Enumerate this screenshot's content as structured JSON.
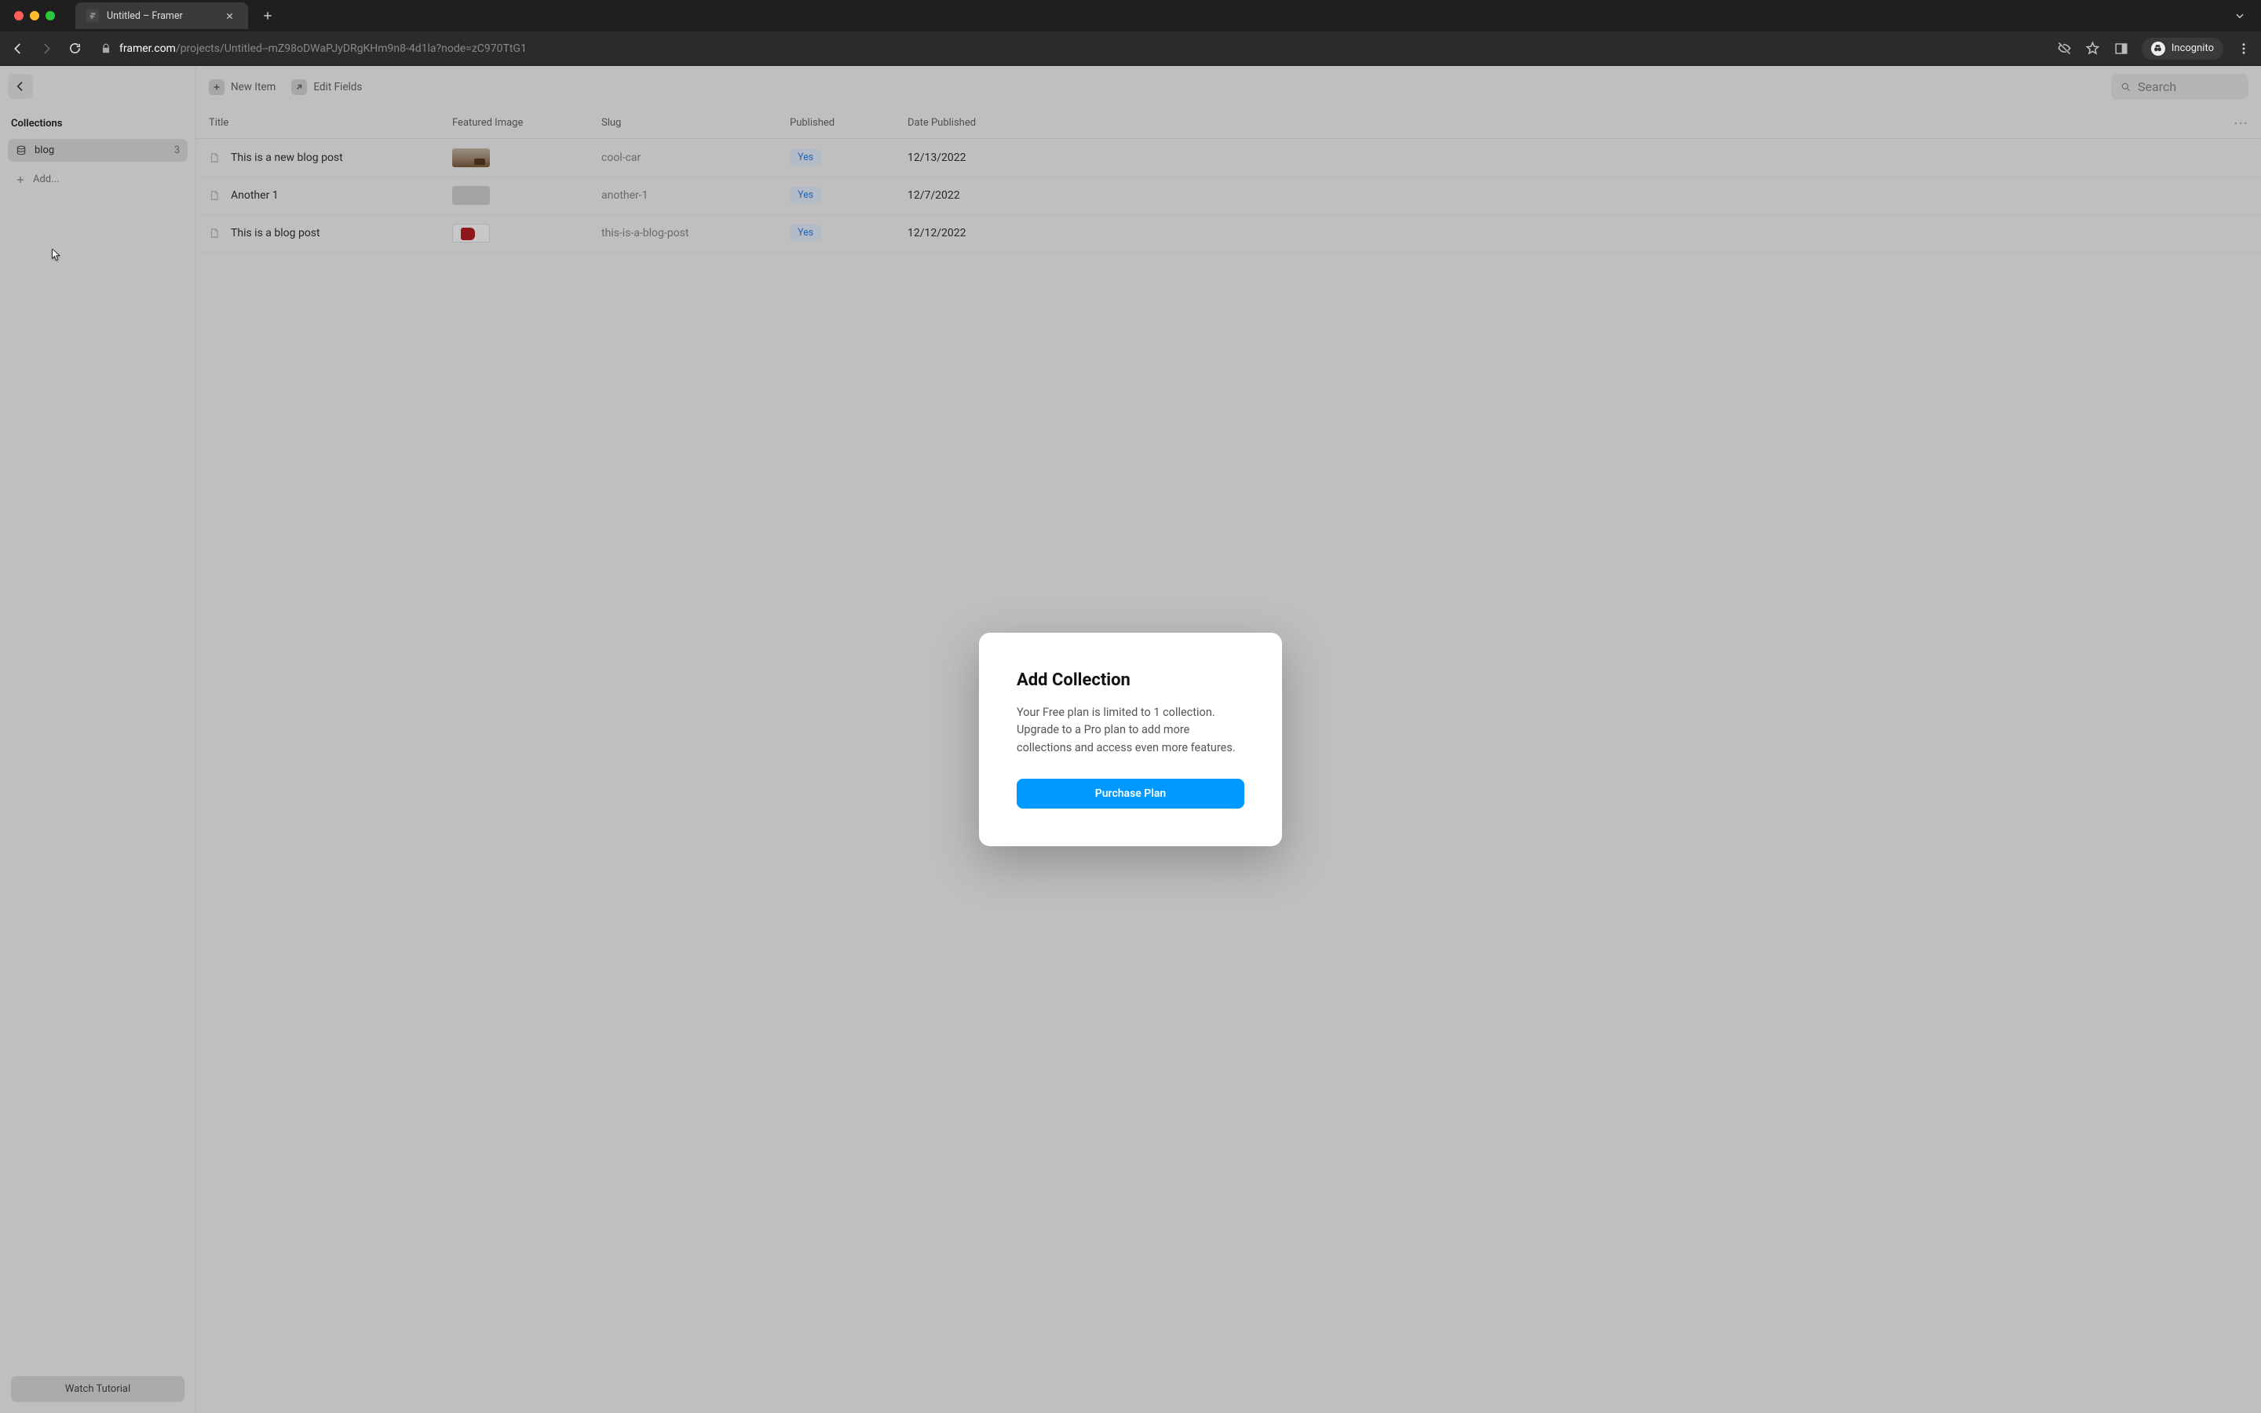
{
  "browser": {
    "tab_title": "Untitled – Framer",
    "url_domain": "framer.com",
    "url_path": "/projects/Untitled--mZ98oDWaPJyDRgKHm9n8-4d1la?node=zC970TtG1",
    "incognito_label": "Incognito"
  },
  "sidebar": {
    "header": "Collections",
    "collection": {
      "name": "blog",
      "count": "3"
    },
    "add_label": "Add...",
    "tutorial_label": "Watch Tutorial"
  },
  "toolbar": {
    "new_item_label": "New Item",
    "edit_fields_label": "Edit Fields",
    "search_placeholder": "Search"
  },
  "table": {
    "columns": {
      "title": "Title",
      "featured_image": "Featured Image",
      "slug": "Slug",
      "published": "Published",
      "date_published": "Date Published"
    },
    "rows": [
      {
        "title": "This is a new blog post",
        "thumb": "car",
        "slug": "cool-car",
        "published": "Yes",
        "date": "12/13/2022"
      },
      {
        "title": "Another 1",
        "thumb": "blank",
        "slug": "another-1",
        "published": "Yes",
        "date": "12/7/2022"
      },
      {
        "title": "This is a blog post",
        "thumb": "mug",
        "slug": "this-is-a-blog-post",
        "published": "Yes",
        "date": "12/12/2022"
      }
    ]
  },
  "modal": {
    "title": "Add Collection",
    "body": "Your Free plan is limited to 1 collection. Upgrade to a Pro plan to add more collections and access even more features.",
    "cta": "Purchase Plan"
  }
}
